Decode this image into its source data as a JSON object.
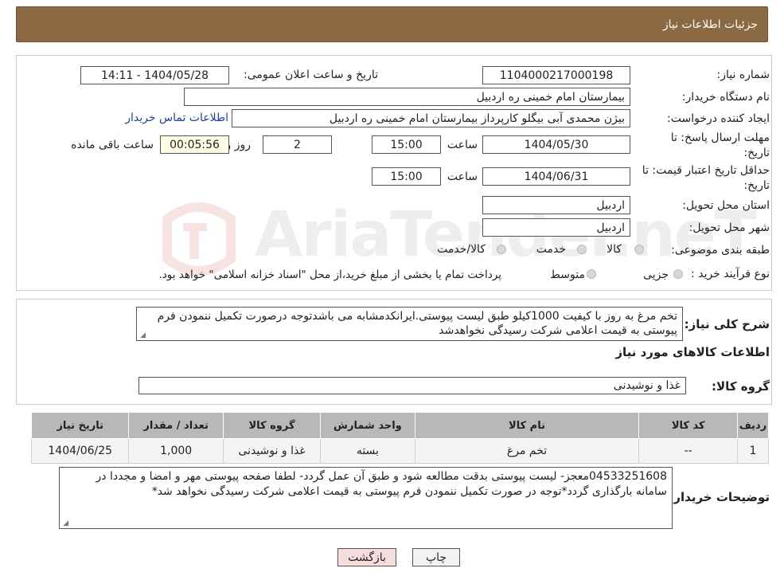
{
  "header": {
    "title": "جزئیات اطلاعات نیاز"
  },
  "fields": {
    "need_number_label": "شماره نیاز:",
    "need_number": "1104000217000198",
    "announce_label": "تاریخ و ساعت اعلان عمومی:",
    "announce_value": "1404/05/28 - 14:11",
    "buyer_org_label": "نام دستگاه خریدار:",
    "buyer_org": "بیمارستان امام خمینی  ره  اردبیل",
    "requester_label": "ایجاد کننده درخواست:",
    "requester": "بیژن محمدی آبی بیگلو کارپرداز بیمارستان امام خمینی  ره  اردبیل",
    "contact_link": "اطلاعات تماس خریدار",
    "deadline_label_1": "مهلت ارسال پاسخ: تا",
    "deadline_label_2": "تاریخ:",
    "deadline_date": "1404/05/30",
    "time_label": "ساعت",
    "deadline_time": "15:00",
    "days_value": "2",
    "days_label": "روز و",
    "remaining_time": "00:05:56",
    "remaining_label": "ساعت باقی مانده",
    "validity_label_1": "حداقل تاریخ اعتبار قیمت: تا",
    "validity_label_2": "تاریخ:",
    "validity_date": "1404/06/31",
    "validity_time_label": "ساعت",
    "validity_time": "15:00",
    "province_label": "استان محل تحویل:",
    "province": "اردبیل",
    "city_label": "شهر محل تحویل:",
    "city": "اردبیل",
    "category_label": "طبقه بندی موضوعی:",
    "category_options": [
      "کالا",
      "خدمت",
      "کالا/خدمت"
    ],
    "process_label": "نوع فرآیند خرید :",
    "process_options": [
      "جزیی",
      "متوسط"
    ],
    "process_note": "پرداخت تمام یا بخشی از مبلغ خرید،از محل \"اسناد خزانه اسلامی\" خواهد بود."
  },
  "description": {
    "label": "شرح کلی نیاز:",
    "text": "تخم مرغ به روز با کیفیت 1000کیلو طبق لیست پیوستی.ایرانکدمشابه می باشدتوجه درصورت تکمیل ننمودن فرم پیوستی به قیمت اعلامی شرکت رسیدگی نخواهدشد"
  },
  "goods_info_title": "اطلاعات کالاهای مورد نیاز",
  "goods_group": {
    "label": "گروه کالا:",
    "value": "غذا و نوشیدنی"
  },
  "table": {
    "headers": [
      "ردیف",
      "کد کالا",
      "نام کالا",
      "واحد شمارش",
      "گروه کالا",
      "تعداد / مقدار",
      "تاریخ نیاز"
    ],
    "rows": [
      [
        "1",
        "--",
        "تخم مرغ",
        "بسته",
        "غذا و نوشیدنی",
        "1,000",
        "1404/06/25"
      ]
    ]
  },
  "buyer_notes": {
    "label": "توضیحات خریدار:",
    "text": "04533251608معجز- لیست پیوستی بدقت مطالعه شود و طبق آن عمل گردد- لطفا صفحه پیوستی مهر و امضا و مجددا در سامانه بارگذاری گردد*توجه در صورت تکمیل ننمودن فرم پیوستی به قیمت اعلامی شرکت رسیدگی نخواهد شد*"
  },
  "buttons": {
    "back": "بازگشت",
    "print": "چاپ"
  },
  "watermark": {
    "text": "AriaTender.neT"
  },
  "colors": {
    "header_bg": "#8b6a43",
    "table_header": "#b8b8b8",
    "back_button": "#f6dede",
    "link": "#1a3fb5"
  }
}
